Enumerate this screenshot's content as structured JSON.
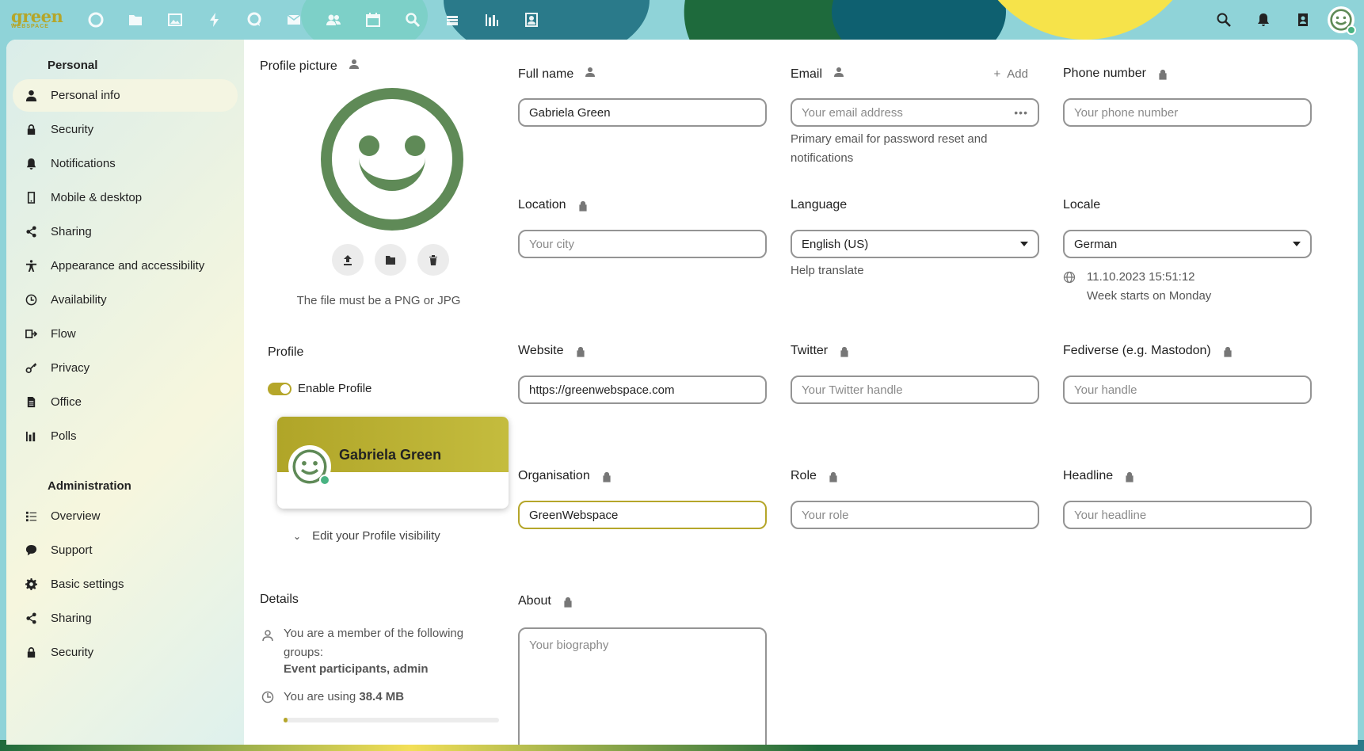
{
  "brand": {
    "logo_word": "green",
    "logo_sub": "WEBSPACE"
  },
  "header": {
    "apps": [
      "dashboard-icon",
      "files-icon",
      "photos-icon",
      "activity-icon",
      "talk-icon",
      "mail-icon",
      "contacts-icon",
      "calendar-icon",
      "search-app-icon",
      "deck-icon",
      "analytics-icon",
      "contacts-card-icon"
    ],
    "right": [
      "search-icon",
      "notifications-icon",
      "contacts-menu-icon",
      "user-avatar"
    ]
  },
  "sidebar": {
    "personal_title": "Personal",
    "personal_items": [
      {
        "label": "Personal info",
        "icon": "person-icon",
        "active": true
      },
      {
        "label": "Security",
        "icon": "lock-icon"
      },
      {
        "label": "Notifications",
        "icon": "bell-icon"
      },
      {
        "label": "Mobile & desktop",
        "icon": "phone-icon"
      },
      {
        "label": "Sharing",
        "icon": "share-icon"
      },
      {
        "label": "Appearance and accessibility",
        "icon": "accessibility-icon"
      },
      {
        "label": "Availability",
        "icon": "clock-icon"
      },
      {
        "label": "Flow",
        "icon": "flow-icon"
      },
      {
        "label": "Privacy",
        "icon": "key-icon"
      },
      {
        "label": "Office",
        "icon": "document-icon"
      },
      {
        "label": "Polls",
        "icon": "poll-icon"
      }
    ],
    "admin_title": "Administration",
    "admin_items": [
      {
        "label": "Overview",
        "icon": "list-icon"
      },
      {
        "label": "Support",
        "icon": "chat-icon"
      },
      {
        "label": "Basic settings",
        "icon": "gear-icon"
      },
      {
        "label": "Sharing",
        "icon": "share-icon"
      },
      {
        "label": "Security",
        "icon": "lock-icon"
      }
    ]
  },
  "profile_picture": {
    "label": "Profile picture",
    "hint": "The file must be a PNG or JPG"
  },
  "profile": {
    "title": "Profile",
    "enable_label": "Enable Profile",
    "enabled": true,
    "card_name": "Gabriela Green",
    "visibility_label": "Edit your Profile visibility"
  },
  "details": {
    "title": "Details",
    "groups_text": "You are a member of the following groups:",
    "groups": "Event participants, admin",
    "usage_prefix": "You are using",
    "usage_value": "38.4 MB",
    "usage_fraction": 0.02
  },
  "fields": {
    "full_name": {
      "label": "Full name",
      "value": "Gabriela Green"
    },
    "email": {
      "label": "Email",
      "placeholder": "Your email address",
      "add_label": "Add",
      "hint": "Primary email for password reset and notifications"
    },
    "phone": {
      "label": "Phone number",
      "placeholder": "Your phone number"
    },
    "location": {
      "label": "Location",
      "placeholder": "Your city"
    },
    "language": {
      "label": "Language",
      "value": "English (US)",
      "hint": "Help translate"
    },
    "locale": {
      "label": "Locale",
      "value": "German",
      "datetime": "11.10.2023 15:51:12",
      "week": "Week starts on Monday"
    },
    "website": {
      "label": "Website",
      "value": "https://greenwebspace.com"
    },
    "twitter": {
      "label": "Twitter",
      "placeholder": "Your Twitter handle"
    },
    "fediverse": {
      "label": "Fediverse (e.g. Mastodon)",
      "placeholder": "Your handle"
    },
    "organisation": {
      "label": "Organisation",
      "value": "GreenWebspace"
    },
    "role": {
      "label": "Role",
      "placeholder": "Your role"
    },
    "headline": {
      "label": "Headline",
      "placeholder": "Your headline"
    },
    "about": {
      "label": "About",
      "placeholder": "Your biography"
    }
  },
  "colors": {
    "accent": "#b5a62a",
    "avatar_green": "#5f8a57",
    "status_online": "#49b382"
  }
}
